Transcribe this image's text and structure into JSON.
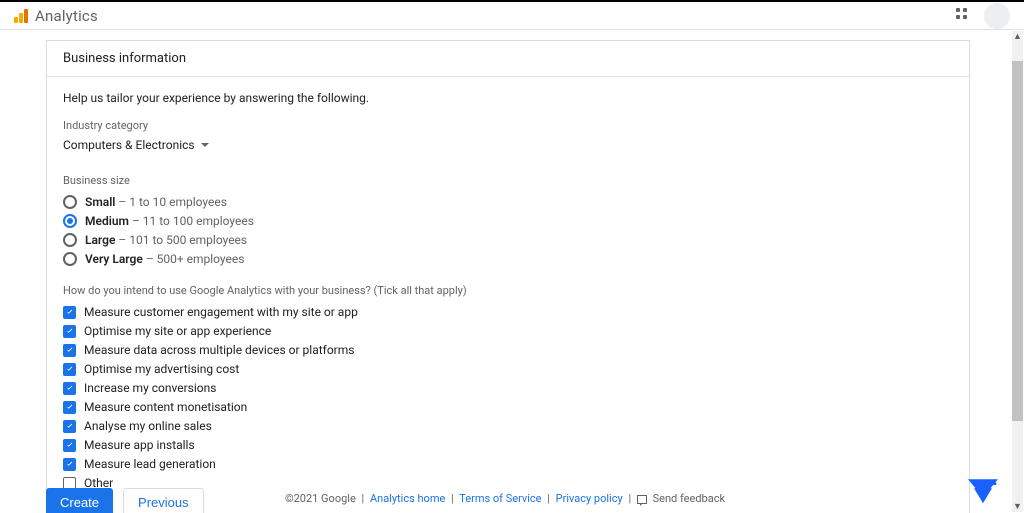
{
  "app_title": "Analytics",
  "card_header": "Business information",
  "intro": "Help us tailor your experience by answering the following.",
  "industry_label": "Industry category",
  "industry_value": "Computers & Electronics",
  "business_size_label": "Business size",
  "sizes": [
    {
      "name": "Small",
      "desc": "1 to 10 employees",
      "selected": false
    },
    {
      "name": "Medium",
      "desc": "11 to 100 employees",
      "selected": true
    },
    {
      "name": "Large",
      "desc": "101 to 500 employees",
      "selected": false
    },
    {
      "name": "Very Large",
      "desc": "500+ employees",
      "selected": false
    }
  ],
  "use_question": "How do you intend to use Google Analytics with your business? (Tick all that apply)",
  "options": [
    {
      "label": "Measure customer engagement with my site or app",
      "checked": true
    },
    {
      "label": "Optimise my site or app experience",
      "checked": true
    },
    {
      "label": "Measure data across multiple devices or platforms",
      "checked": true
    },
    {
      "label": "Optimise my advertising cost",
      "checked": true
    },
    {
      "label": "Increase my conversions",
      "checked": true
    },
    {
      "label": "Measure content monetisation",
      "checked": true
    },
    {
      "label": "Analyse my online sales",
      "checked": true
    },
    {
      "label": "Measure app installs",
      "checked": true
    },
    {
      "label": "Measure lead generation",
      "checked": true
    },
    {
      "label": "Other",
      "checked": false
    }
  ],
  "buttons": {
    "create": "Create",
    "previous": "Previous"
  },
  "footer": {
    "copyright": "©2021 Google",
    "links": [
      "Analytics home",
      "Terms of Service",
      "Privacy policy"
    ],
    "feedback": "Send feedback"
  }
}
